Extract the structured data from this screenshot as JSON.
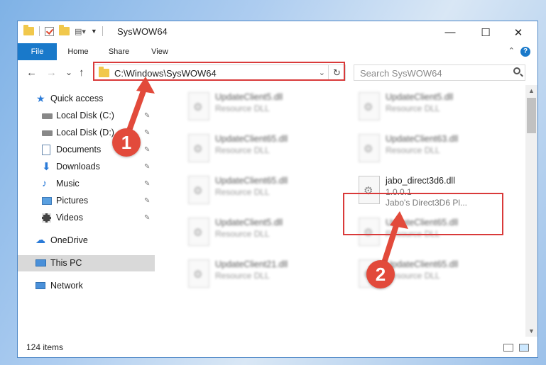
{
  "window": {
    "title": "SysWOW64",
    "controls": {
      "minimize": "—",
      "maximize": "☐",
      "close": "✕"
    }
  },
  "ribbon": {
    "tabs": [
      "File",
      "Home",
      "Share",
      "View"
    ],
    "help": "?",
    "collapse": "⌃"
  },
  "navigation": {
    "back": "←",
    "forward": "→",
    "recent": "⌄",
    "up": "↑",
    "address": "C:\\Windows\\SysWOW64",
    "address_dropdown": "⌄",
    "refresh": "↻",
    "search_placeholder": "Search SysWOW64"
  },
  "sidebar": {
    "items": [
      {
        "label": "Quick access",
        "icon": "star-icon"
      },
      {
        "label": "Local Disk (C:)",
        "icon": "drive-icon",
        "pinned": true
      },
      {
        "label": "Local Disk (D:)",
        "icon": "drive-icon",
        "pinned": true
      },
      {
        "label": "Documents",
        "icon": "documents-icon",
        "pinned": true
      },
      {
        "label": "Downloads",
        "icon": "download-icon",
        "pinned": true
      },
      {
        "label": "Music",
        "icon": "music-icon",
        "pinned": true
      },
      {
        "label": "Pictures",
        "icon": "pictures-icon",
        "pinned": true
      },
      {
        "label": "Videos",
        "icon": "videos-icon",
        "pinned": true
      },
      {
        "label": "OneDrive",
        "icon": "cloud-icon"
      },
      {
        "label": "This PC",
        "icon": "computer-icon",
        "selected": true
      },
      {
        "label": "Network",
        "icon": "network-icon"
      }
    ],
    "pin": "📌"
  },
  "files": [
    {
      "name": "UpdateClient5.dll",
      "desc": "Resource DLL",
      "blurred": true
    },
    {
      "name": "UpdateClient5.dll",
      "desc": "Resource DLL",
      "blurred": true
    },
    {
      "name": "UpdateClient65.dll",
      "desc": "Resource DLL",
      "blurred": true
    },
    {
      "name": "UpdateClient63.dll",
      "desc": "Resource DLL",
      "blurred": true
    },
    {
      "name": "UpdateClient65.dll",
      "desc": "Resource DLL",
      "blurred": true
    },
    {
      "name": "jabo_direct3d6.dll",
      "desc": "1.0.0.1",
      "desc2": "Jabo's Direct3D6 Pl...",
      "blurred": false
    },
    {
      "name": "UpdateClient5.dll",
      "desc": "Resource DLL",
      "blurred": true
    },
    {
      "name": "UpdateClient65.dll",
      "desc": "Resource DLL",
      "blurred": true
    },
    {
      "name": "UpdateClient21.dll",
      "desc": "Resource DLL",
      "blurred": true
    },
    {
      "name": "UpdateClient65.dll",
      "desc": "Resource DLL",
      "blurred": true
    }
  ],
  "status": {
    "item_count": "124 items"
  },
  "annotations": {
    "step1": "1",
    "step2": "2",
    "color": "#e24a3b"
  }
}
